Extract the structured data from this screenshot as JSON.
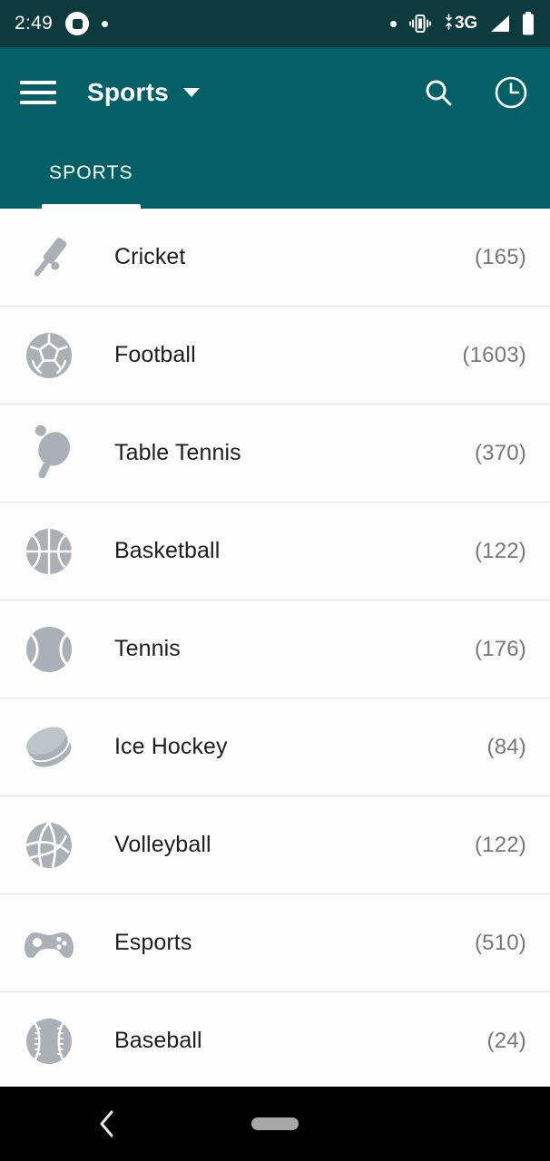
{
  "status_bar": {
    "time": "2:49",
    "recording_icon": "screen-record-icon",
    "notification_dot": "notification-dot-icon",
    "right_dot": "status-dot-icon",
    "vibrate_icon": "vibrate-icon",
    "network_type": "3G",
    "data_arrows": "data-transfer-arrows-icon",
    "signal_icon": "signal-strength-icon",
    "battery_icon": "battery-full-icon"
  },
  "app_bar": {
    "menu_icon": "hamburger-menu-icon",
    "title": "Sports",
    "dropdown_icon": "chevron-down-icon",
    "search_icon": "search-icon",
    "history_icon": "clock-history-icon"
  },
  "tabs": [
    {
      "label": "SPORTS",
      "active": true
    }
  ],
  "sports": [
    {
      "name": "Cricket",
      "count": "(165)",
      "icon": "cricket-bat-icon"
    },
    {
      "name": "Football",
      "count": "(1603)",
      "icon": "football-icon"
    },
    {
      "name": "Table Tennis",
      "count": "(370)",
      "icon": "table-tennis-paddle-icon"
    },
    {
      "name": "Basketball",
      "count": "(122)",
      "icon": "basketball-icon"
    },
    {
      "name": "Tennis",
      "count": "(176)",
      "icon": "tennis-ball-icon"
    },
    {
      "name": "Ice Hockey",
      "count": "(84)",
      "icon": "hockey-puck-icon"
    },
    {
      "name": "Volleyball",
      "count": "(122)",
      "icon": "volleyball-icon"
    },
    {
      "name": "Esports",
      "count": "(510)",
      "icon": "gamepad-icon"
    },
    {
      "name": "Baseball",
      "count": "(24)",
      "icon": "baseball-icon"
    }
  ],
  "nav_bar": {
    "back_icon": "back-chevron-icon",
    "home_pill": "home-gesture-pill"
  },
  "colors": {
    "status_bar_bg": "#0d3b3d",
    "app_bar_bg": "#046066",
    "list_bg": "#fdfdfd",
    "divider": "#e3e3e6",
    "label_text": "#1e1e1e",
    "count_text": "#777777",
    "sport_icon": "#aab0b5",
    "nav_bar_bg": "#000000"
  }
}
